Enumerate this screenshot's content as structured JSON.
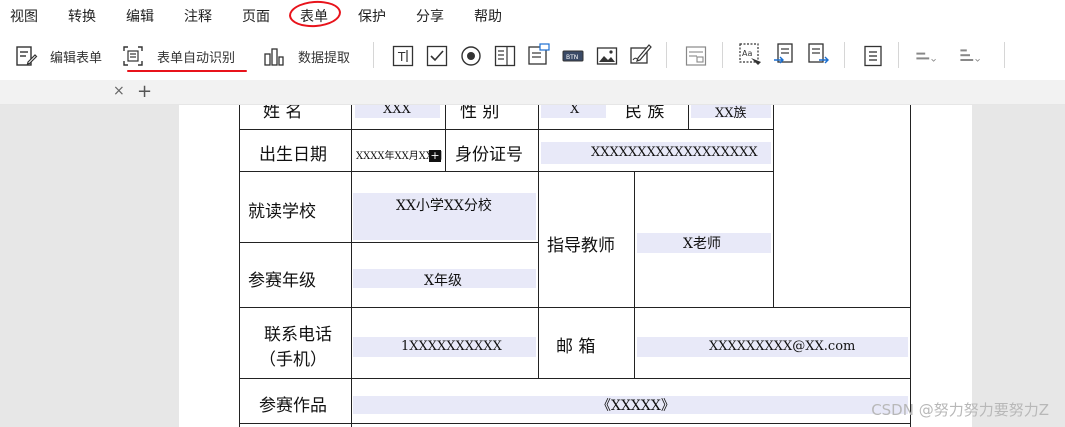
{
  "menu": {
    "items": [
      "视图",
      "转换",
      "编辑",
      "注释",
      "页面",
      "表单",
      "保护",
      "分享",
      "帮助"
    ]
  },
  "toolbar": {
    "edit_form_label": "编辑表单",
    "auto_recognize_label": "表单自动识别",
    "data_extract_label": "数据提取"
  },
  "tabs": {
    "close_glyph": "×",
    "add_glyph": "+"
  },
  "form": {
    "row1": {
      "name_label": "姓 名",
      "name_value": "XXX",
      "gender_label": "性 别",
      "gender_value": "X",
      "ethnic_label": "民 族",
      "ethnic_value": "XX族"
    },
    "birth_label": "出生日期",
    "birth_value": "XXXX年XX月XX日",
    "id_label": "身份证号",
    "id_value": "XXXXXXXXXXXXXXXXXX",
    "school_label": "就读学校",
    "school_value": "XX小学XX分校",
    "grade_label": "参赛年级",
    "grade_value": "X年级",
    "teacher_label": "指导教师",
    "teacher_value": "X老师",
    "phone_label_line1": "联系电话",
    "phone_label_line2": "（手机）",
    "phone_value": "1XXXXXXXXXX",
    "email_label": "邮 箱",
    "email_value": "XXXXXXXXX@XX.com",
    "work_label": "参赛作品",
    "work_value": "《XXXXX》"
  },
  "watermark": "CSDN @努力努力要努力Z",
  "colors": {
    "annotation_red": "#e8131b",
    "field_fill": "#e8e9f8",
    "workspace_gray": "#e7e7e7"
  }
}
